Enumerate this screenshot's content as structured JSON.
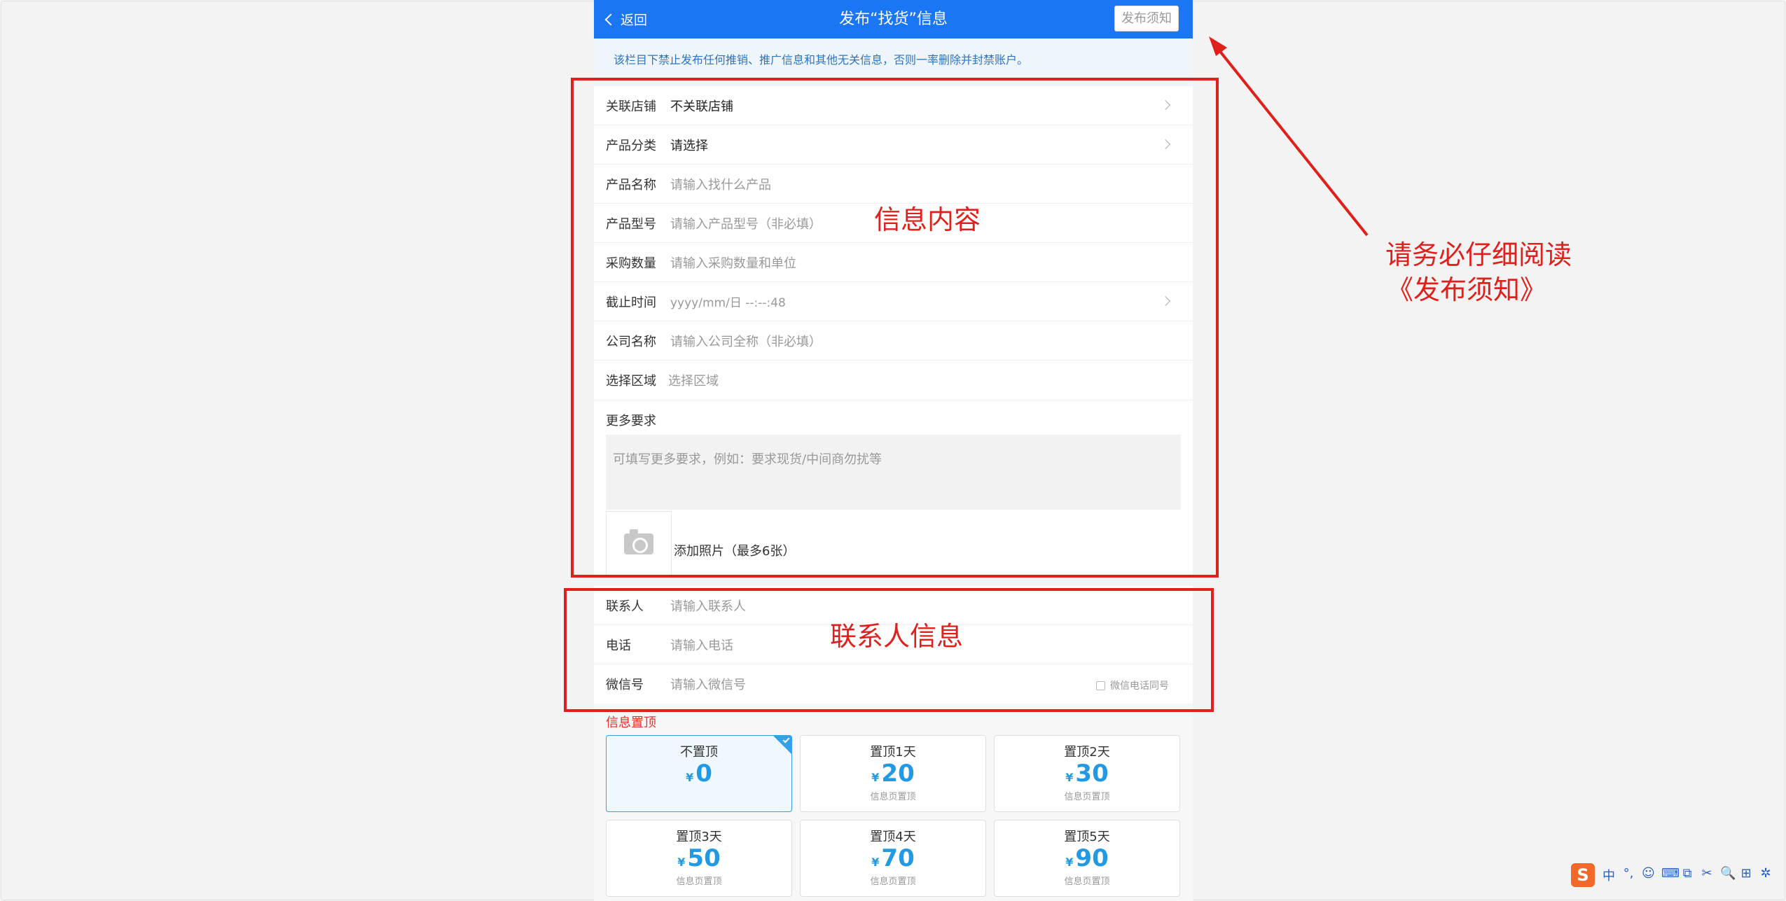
{
  "header": {
    "back_label": "返回",
    "title": "发布“找货”信息",
    "notice_button": "发布须知"
  },
  "warning": "该栏目下禁止发布任何推销、推广信息和其他无关信息，否则一率删除并封禁账户。",
  "form": {
    "store": {
      "label": "关联店铺",
      "value": "不关联店铺"
    },
    "category": {
      "label": "产品分类",
      "value": "请选择"
    },
    "product_name": {
      "label": "产品名称",
      "placeholder": "请输入找什么产品"
    },
    "model": {
      "label": "产品型号",
      "placeholder": "请输入产品型号（非必填）"
    },
    "quantity": {
      "label": "采购数量",
      "placeholder": "请输入采购数量和单位"
    },
    "deadline": {
      "label": "截止时间",
      "placeholder": "yyyy/mm/日 --:--:48"
    },
    "company": {
      "label": "公司名称",
      "placeholder": "请输入公司全称（非必填）"
    },
    "region": {
      "label": "选择区域",
      "placeholder": "选择区域"
    },
    "more": {
      "label": "更多要求",
      "placeholder": "可填写更多要求，例如：要求现货/中间商勿扰等"
    },
    "photo_label": "添加照片（最多6张）"
  },
  "contact": {
    "person": {
      "label": "联系人",
      "placeholder": "请输入联系人"
    },
    "phone": {
      "label": "电话",
      "placeholder": "请输入电话"
    },
    "wechat": {
      "label": "微信号",
      "placeholder": "请输入微信号"
    },
    "same_as_phone": "微信电话同号"
  },
  "top_section": {
    "title": "信息置顶",
    "currency": "¥",
    "options": [
      {
        "name": "不置顶",
        "price": "0",
        "sub": "",
        "selected": true
      },
      {
        "name": "置顶1天",
        "price": "20",
        "sub": "信息页置顶",
        "selected": false
      },
      {
        "name": "置顶2天",
        "price": "30",
        "sub": "信息页置顶",
        "selected": false
      },
      {
        "name": "置顶3天",
        "price": "50",
        "sub": "信息页置顶",
        "selected": false
      },
      {
        "name": "置顶4天",
        "price": "70",
        "sub": "信息页置顶",
        "selected": false
      },
      {
        "name": "置顶5天",
        "price": "90",
        "sub": "信息页置顶",
        "selected": false
      }
    ]
  },
  "annotations": {
    "info_content": "信息内容",
    "contact_info": "联系人信息",
    "notice_line1": "请务必仔细阅读",
    "notice_line2": "《发布须知》"
  },
  "ime": {
    "logo": "S",
    "items": [
      "中",
      "°,",
      "☺",
      "⌨",
      "⧉",
      "✂",
      "🔍",
      "⊞",
      "✲"
    ]
  },
  "colors": {
    "header_blue": "#1a76f5",
    "annotation_red": "#e0201b",
    "price_blue": "#2199e3"
  }
}
